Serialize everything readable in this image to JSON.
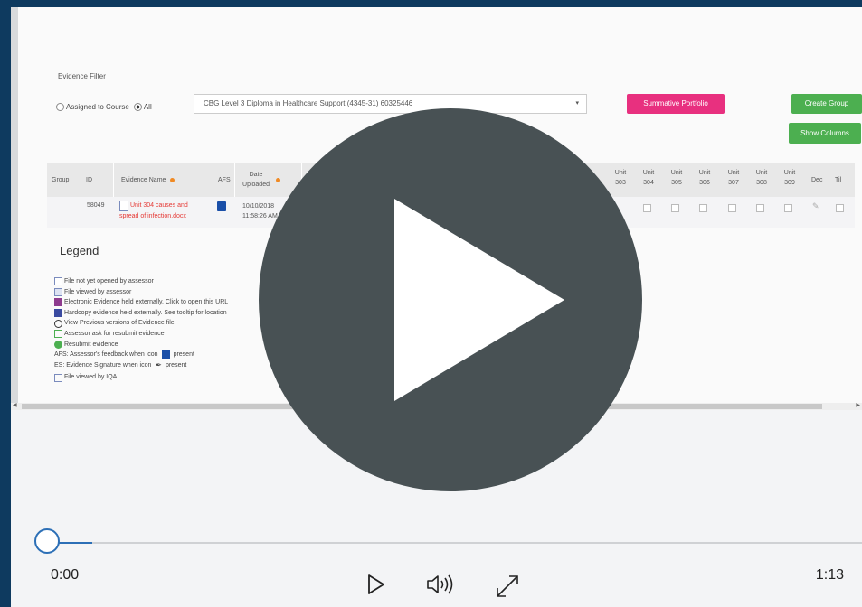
{
  "evidence_filter": {
    "title": "Evidence Filter",
    "radio_assigned": "Assigned to Course",
    "radio_all": "All",
    "selected_course": "CBG Level 3 Diploma in Healthcare Support (4345-31) 60325446"
  },
  "buttons": {
    "summative": "Summative Portfolio",
    "create_group": "Create Group",
    "show_columns": "Show Columns"
  },
  "table": {
    "headers": {
      "group": "Group",
      "id": "ID",
      "evidence_name": "Evidence Name",
      "afs": "AFS",
      "date_uploaded": "Date Uploaded"
    },
    "units": [
      {
        "label": "Unit 303"
      },
      {
        "label": "Unit 304"
      },
      {
        "label": "Unit 305"
      },
      {
        "label": "Unit 306"
      },
      {
        "label": "Unit 307"
      },
      {
        "label": "Unit 308"
      },
      {
        "label": "Unit 309"
      }
    ],
    "extra_cols": {
      "dec": "Dec",
      "til": "Til"
    },
    "row": {
      "id": "58049",
      "evidence_name": "Unit 304 causes and spread of infection.docx",
      "date": "10/10/2018",
      "time": "11:58:26 AM"
    }
  },
  "legend": {
    "title": "Legend",
    "items": [
      "File not yet opened by assessor",
      "File viewed by assessor",
      "Electronic Evidence held externally. Click to open this URL",
      "Hardcopy evidence held externally. See tooltip for location",
      "View Previous versions of Evidence file.",
      "Assessor ask for resubmit evidence",
      "Resubmit evidence",
      "AFS: Assessor's feedback when icon",
      "ES: Evidence Signature when icon",
      "File viewed by IQA"
    ],
    "present": "present"
  },
  "player": {
    "current_time": "0:00",
    "duration": "1:13",
    "progress_fraction": 0.0
  },
  "colors": {
    "accent_blue": "#2c6fb6",
    "pink": "#e8307f",
    "green": "#4caf50",
    "overlay": "#485154"
  }
}
